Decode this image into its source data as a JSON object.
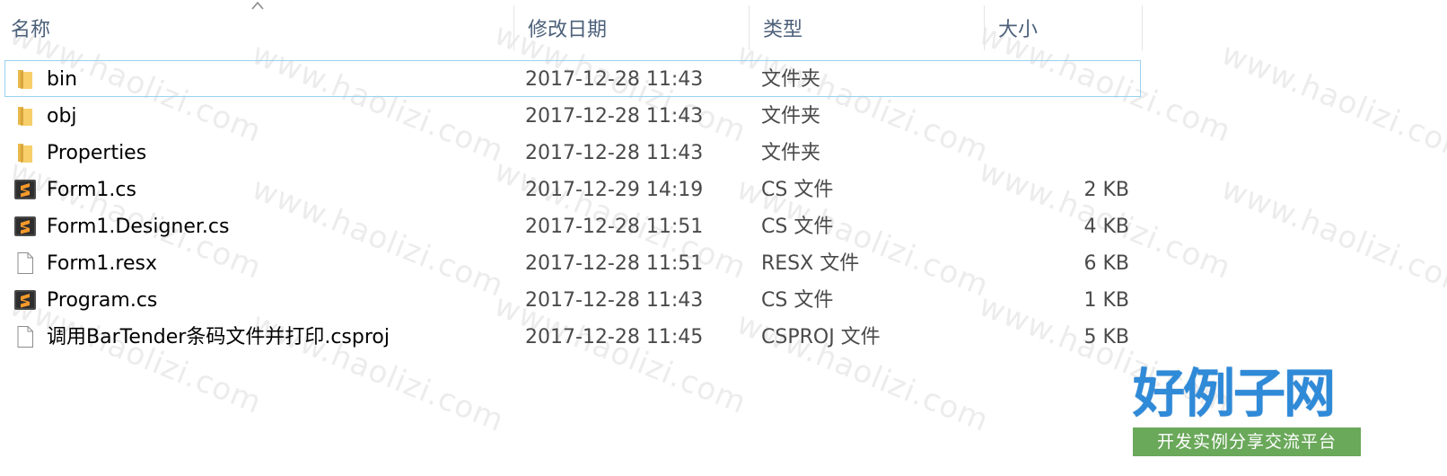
{
  "columns": {
    "name": "名称",
    "date": "修改日期",
    "type": "类型",
    "size": "大小"
  },
  "sort": {
    "column": "name",
    "direction": "ascending"
  },
  "files": [
    {
      "name": "bin",
      "date": "2017-12-28 11:43",
      "type": "文件夹",
      "size": "",
      "icon": "folder-icon",
      "focused": true
    },
    {
      "name": "obj",
      "date": "2017-12-28 11:43",
      "type": "文件夹",
      "size": "",
      "icon": "folder-icon"
    },
    {
      "name": "Properties",
      "date": "2017-12-28 11:43",
      "type": "文件夹",
      "size": "",
      "icon": "folder-icon"
    },
    {
      "name": "Form1.cs",
      "date": "2017-12-29 14:19",
      "type": "CS 文件",
      "size": "2 KB",
      "icon": "sublime-file-icon"
    },
    {
      "name": "Form1.Designer.cs",
      "date": "2017-12-28 11:51",
      "type": "CS 文件",
      "size": "4 KB",
      "icon": "sublime-file-icon"
    },
    {
      "name": "Form1.resx",
      "date": "2017-12-28 11:51",
      "type": "RESX 文件",
      "size": "6 KB",
      "icon": "blank-file-icon"
    },
    {
      "name": "Program.cs",
      "date": "2017-12-28 11:43",
      "type": "CS 文件",
      "size": "1 KB",
      "icon": "sublime-file-icon"
    },
    {
      "name": "调用BarTender条码文件并打印.csproj",
      "date": "2017-12-28 11:45",
      "type": "CSPROJ 文件",
      "size": "5 KB",
      "icon": "blank-file-icon"
    }
  ],
  "watermark": {
    "text": "www.haolizi.com"
  },
  "logo": {
    "title": "好例子网",
    "subtitle": "开发实例分享交流平台"
  },
  "colors": {
    "header_text": "#4c607a",
    "focus_border": "#99d1ef",
    "folder": "#f4c55a",
    "logo_blue": "#2f8ad8",
    "logo_green": "#6aa85a"
  }
}
